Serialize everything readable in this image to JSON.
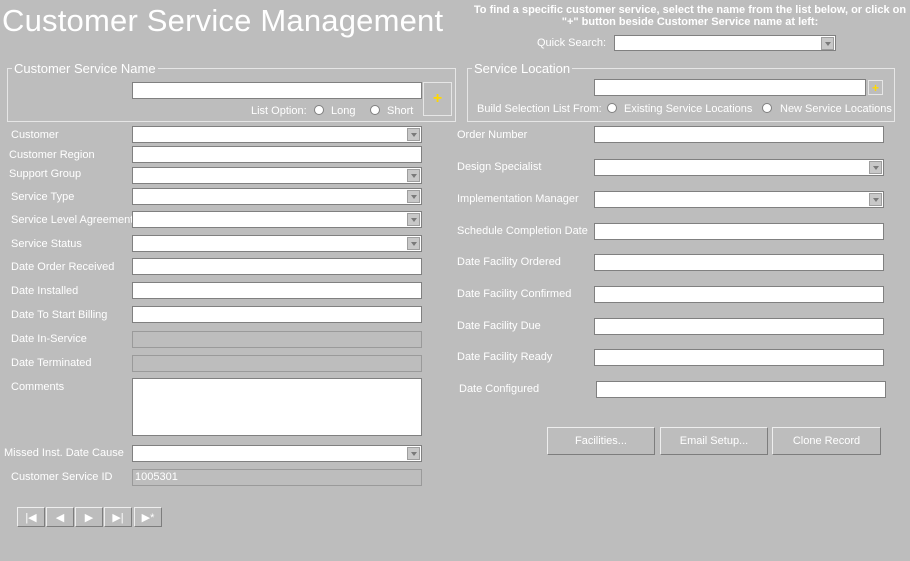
{
  "page": {
    "title": "Customer Service Management",
    "hint": "To find a specific customer service, select the name from the list below, or click on \"+\" button beside Customer Service name at left:",
    "quick_search_label": "Quick Search:"
  },
  "customer_service_name": {
    "legend": "Customer Service Name",
    "list_option_label": "List Option:",
    "option_long": "Long",
    "option_short": "Short"
  },
  "service_location": {
    "legend": "Service Location",
    "build_label": "Build Selection List From:",
    "option_existing": "Existing Service Locations",
    "option_new": "New Service Locations"
  },
  "left_fields": {
    "customer": "Customer",
    "customer_region": "Customer Region",
    "support_group": "Support Group",
    "service_type": "Service Type",
    "sla": "Service Level Agreement",
    "service_status": "Service Status",
    "date_order_received": "Date Order Received",
    "date_installed": "Date Installed",
    "date_start_billing": "Date To Start Billing",
    "date_in_service": "Date In-Service",
    "date_terminated": "Date Terminated",
    "comments": "Comments",
    "missed_cause": "Missed Inst. Date Cause",
    "customer_service_id": "Customer Service ID",
    "customer_service_id_value": "1005301"
  },
  "right_fields": {
    "order_number": "Order Number",
    "design_specialist": "Design Specialist",
    "implementation_manager": "Implementation Manager",
    "schedule_completion": "Schedule Completion Date",
    "facility_ordered": "Date Facility Ordered",
    "facility_confirmed": "Date Facility Confirmed",
    "facility_due": "Date Facility Due",
    "facility_ready": "Date Facility Ready",
    "date_configured": "Date Configured"
  },
  "buttons": {
    "facilities": "Facilities...",
    "email_setup": "Email Setup...",
    "clone_record": "Clone Record"
  },
  "nav": {
    "first": "|◀",
    "prev": "◀",
    "next": "▶",
    "last": "▶|",
    "new": "▶*"
  },
  "icons": {
    "plus": "+"
  }
}
